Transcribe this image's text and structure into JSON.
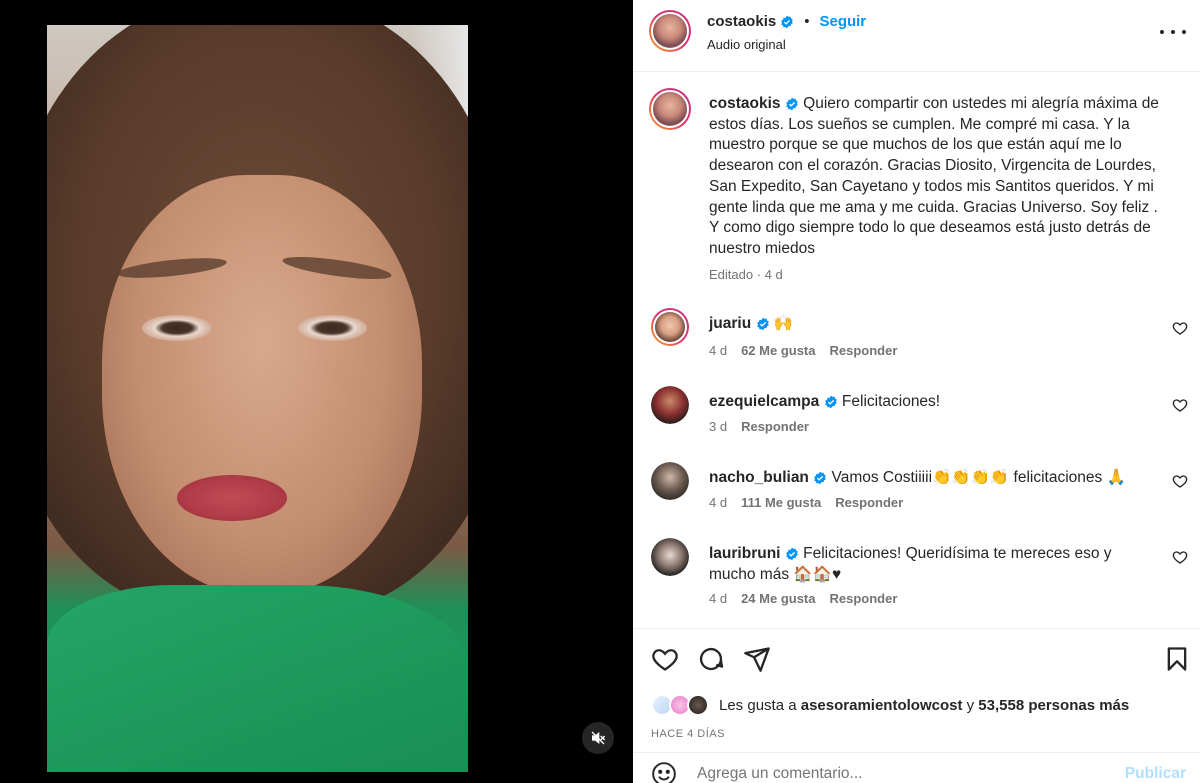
{
  "post": {
    "username": "costaokis",
    "follow_label": "Seguir",
    "separator": "•",
    "audio": "Audio original",
    "caption_text": "Quiero compartir con ustedes mi alegría máxima de estos días. Los sueños se cumplen. Me compré mi casa. Y la muestro porque se que muchos de los que están aquí me lo desearon con el corazón. Gracias Diosito, Virgencita de Lourdes, San Expedito, San Cayetano y todos mis Santitos queridos. Y mi gente linda que me ama y me cuida. Gracias Universo. Soy feliz . Y como digo siempre todo lo que deseamos está justo detrás de nuestro miedos",
    "caption_meta": "Editado · 4 d"
  },
  "comments": [
    {
      "user": "juariu",
      "text": "🙌",
      "age": "4 d",
      "likes": "62 Me gusta",
      "reply": "Responder"
    },
    {
      "user": "ezequielcampa",
      "text": "Felicitaciones!",
      "age": "3 d",
      "likes": "",
      "reply": "Responder"
    },
    {
      "user": "nacho_bulian",
      "text": "Vamos Costiiiii👏👏👏👏 felicitaciones 🙏",
      "age": "4 d",
      "likes": "111 Me gusta",
      "reply": "Responder"
    },
    {
      "user": "lauribruni",
      "text": "Felicitaciones! Queridísima te mereces eso y mucho más 🏠🏠♥",
      "age": "4 d",
      "likes": "24 Me gusta",
      "reply": "Responder"
    }
  ],
  "likes": {
    "prefix": "Les gusta a",
    "user": "asesoramientolowcost",
    "connector": "y",
    "others": "53,558 personas más"
  },
  "time_ago": "HACE 4 DÍAS",
  "add_comment": {
    "placeholder": "Agrega un comentario...",
    "publish_label": "Publicar"
  },
  "icons": {
    "verified": "verified-badge-icon",
    "more": "more-options-icon",
    "like": "heart-icon",
    "comment": "comment-icon",
    "share": "share-icon",
    "save": "bookmark-icon",
    "mute": "muted-speaker-icon",
    "emoji": "emoji-icon"
  },
  "colors": {
    "accent": "#0095f6",
    "verified": "#0095f6",
    "publish_disabled": "#b2dffc",
    "muted_text": "#737373"
  }
}
